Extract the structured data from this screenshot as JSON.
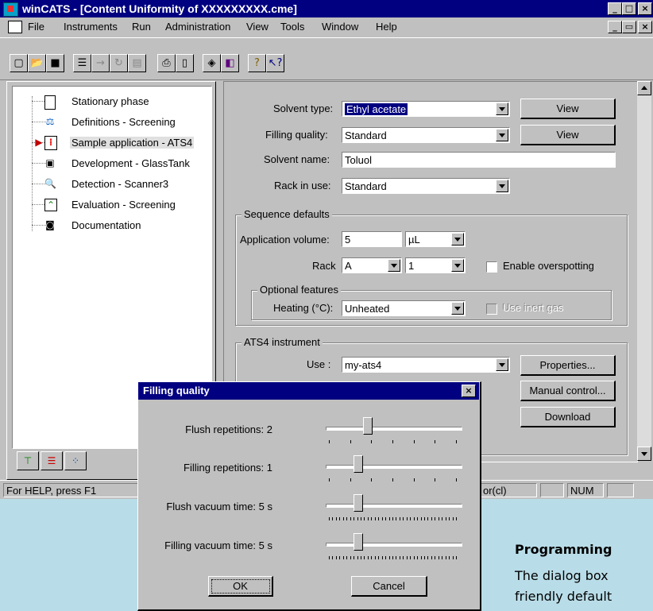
{
  "app": {
    "title": "winCATS - [Content Uniformity of XXXXXXXXX.cme]",
    "caption_min": "_",
    "caption_max": "□",
    "caption_close": "×",
    "doc_min": "_",
    "doc_restore": "▭",
    "doc_close": "×"
  },
  "menu": [
    "File",
    "Instruments",
    "Run",
    "Administration",
    "View",
    "Tools",
    "Window",
    "Help"
  ],
  "toolbar_icons": [
    "new-icon",
    "open-icon",
    "save-icon",
    "list-icon",
    "arrow-right-icon",
    "refresh-icon",
    "edit-icon",
    "print-icon",
    "print-preview-icon",
    "diamond-icon",
    "page-icon",
    "help-icon",
    "context-help-icon"
  ],
  "tree": {
    "items": [
      {
        "label": "Stationary phase",
        "icon": "plate-icon"
      },
      {
        "label": "Definitions - Screening",
        "icon": "balance-icon"
      },
      {
        "label": "Sample application - ATS4",
        "icon": "sample-icon",
        "selected": true
      },
      {
        "label": "Development - GlassTank",
        "icon": "tank-icon"
      },
      {
        "label": "Detection - Scanner3",
        "icon": "scanner-icon"
      },
      {
        "label": "Evaluation - Screening",
        "icon": "chart-icon"
      },
      {
        "label": "Documentation",
        "icon": "camera-icon"
      }
    ],
    "tabs": [
      "tree-tab-icon",
      "list-tab-icon",
      "dots-tab-icon"
    ]
  },
  "form": {
    "solvent_type_label": "Solvent type:",
    "solvent_type_value": "Ethyl acetate",
    "filling_quality_label": "Filling quality:",
    "filling_quality_value": "Standard",
    "solvent_name_label": "Solvent name:",
    "solvent_name_value": "Toluol",
    "rack_in_use_label": "Rack in use:",
    "rack_in_use_value": "Standard",
    "view_button": "View",
    "view_button_2": "View",
    "sequence_defaults_title": "Sequence defaults",
    "application_volume_label": "Application volume:",
    "application_volume_value": "5",
    "application_volume_unit": "µL",
    "rack_label": "Rack",
    "rack_value": "A",
    "rack_number": "1",
    "enable_overspotting_label": "Enable overspotting",
    "optional_features_title": "Optional features",
    "heating_label": "Heating (°C):",
    "heating_value": "Unheated",
    "use_inert_gas_label": "Use inert gas",
    "ats4_title": "ATS4 instrument",
    "use_label": "Use :",
    "use_value": "my-ats4",
    "properties_button": "Properties...",
    "manual_control_button": "Manual control...",
    "download_button": "Download"
  },
  "status": {
    "help_text": "For HELP, press F1",
    "mode_text": "or(cl)",
    "num_text": "NUM"
  },
  "dialog": {
    "title": "Filling quality",
    "close": "×",
    "sliders": [
      {
        "label": "Flush repetitions:  2",
        "level": 0.3
      },
      {
        "label": "Filling repetitions:  1",
        "level": 0.22
      },
      {
        "label": "Flush vacuum time:  5  s",
        "level": 0.22
      },
      {
        "label": "Filling vacuum time:  5  s",
        "level": 0.22
      }
    ],
    "ok_button": "OK",
    "cancel_button": "Cancel"
  },
  "doc_text": {
    "heading": "Programming",
    "line1": "The dialog box",
    "line2": "friendly default"
  },
  "colors": {
    "titlebar": "#000080",
    "background": "#b9dde8",
    "window": "#c0c0c0"
  }
}
